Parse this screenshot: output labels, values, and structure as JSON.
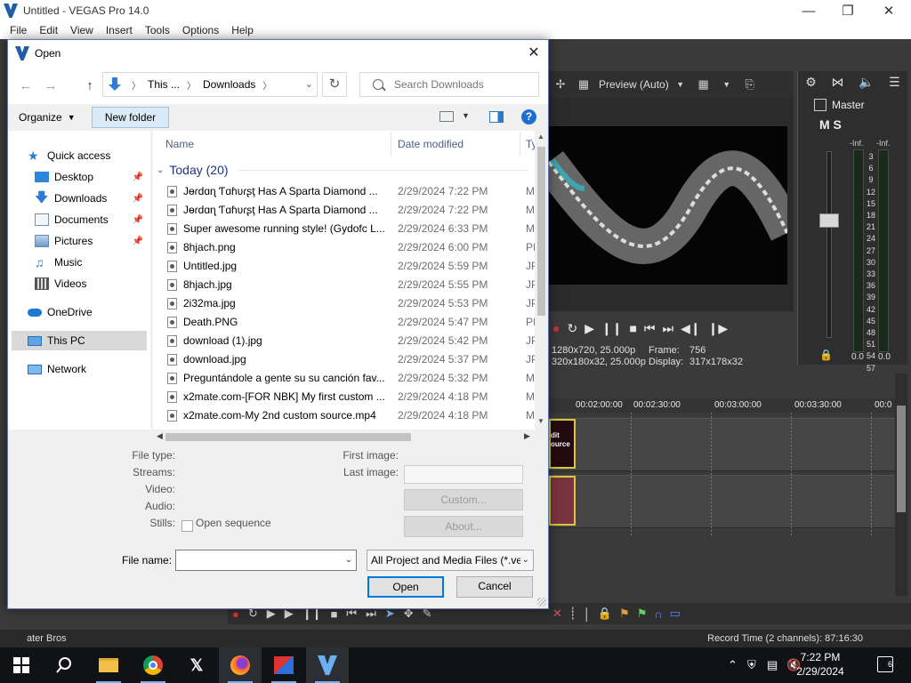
{
  "app": {
    "title": "Untitled - VEGAS Pro 14.0",
    "menu": [
      "File",
      "Edit",
      "View",
      "Insert",
      "Tools",
      "Options",
      "Help"
    ],
    "preview_quality": "Preview (Auto)",
    "project_info": "1280x720, 25.000p",
    "preview_info": "320x180x32, 25.000p",
    "frame_label": "Frame:",
    "frame_value": "756",
    "display_label": "Display:",
    "display_value": "317x178x32",
    "mixer_title": "Master",
    "mixer_ms": "M  S",
    "meter_inf": "-Inf.",
    "meter_scale": [
      "3",
      "6",
      "9",
      "12",
      "15",
      "18",
      "21",
      "24",
      "27",
      "30",
      "33",
      "36",
      "39",
      "42",
      "45",
      "48",
      "51",
      "54",
      "57"
    ],
    "meter_val": "0.0",
    "timeline_marks": [
      "00:02:00:00",
      "00:02:30:00",
      "00:03:00:00",
      "00:03:30:00",
      "00:0"
    ],
    "clip_label": "dit ource",
    "record_time": "Record Time (2 channels): 87:16:30",
    "status_left": "ater Bros"
  },
  "dialog": {
    "title": "Open",
    "close": "✕",
    "address": {
      "part1": "This ...",
      "part2": "Downloads"
    },
    "search_placeholder": "Search Downloads",
    "organize": "Organize",
    "new_folder": "New folder",
    "nav": [
      {
        "label": "Quick access"
      },
      {
        "label": "Desktop"
      },
      {
        "label": "Downloads"
      },
      {
        "label": "Documents"
      },
      {
        "label": "Pictures"
      },
      {
        "label": "Music"
      },
      {
        "label": "Videos"
      },
      {
        "label": "OneDrive"
      },
      {
        "label": "This PC"
      },
      {
        "label": "Network"
      }
    ],
    "columns": {
      "name": "Name",
      "date": "Date modified",
      "type": "Ty"
    },
    "group": "Today (20)",
    "files": [
      {
        "name": "Jɵɾԁɑɳ Ƭɑɦʋɾʂţ Has A Sparta Diamond ...",
        "date": "2/29/2024 7:22 PM",
        "type": "M"
      },
      {
        "name": "Jɵɾԁɑɳ Ƭɑɦʋɾʂţ Has A Sparta Diamond ...",
        "date": "2/29/2024 7:22 PM",
        "type": "M"
      },
      {
        "name": "Super awesome running style! (Gydofc L...",
        "date": "2/29/2024 6:33 PM",
        "type": "M"
      },
      {
        "name": "8hjach.png",
        "date": "2/29/2024 6:00 PM",
        "type": "PI"
      },
      {
        "name": "Untitled.jpg",
        "date": "2/29/2024 5:59 PM",
        "type": "JP"
      },
      {
        "name": "8hjach.jpg",
        "date": "2/29/2024 5:55 PM",
        "type": "JP"
      },
      {
        "name": "2i32ma.jpg",
        "date": "2/29/2024 5:53 PM",
        "type": "JP"
      },
      {
        "name": "Death.PNG",
        "date": "2/29/2024 5:47 PM",
        "type": "PI"
      },
      {
        "name": "download (1).jpg",
        "date": "2/29/2024 5:42 PM",
        "type": "JP"
      },
      {
        "name": "download.jpg",
        "date": "2/29/2024 5:37 PM",
        "type": "JP"
      },
      {
        "name": "Preguntándole a gente su su canción fav...",
        "date": "2/29/2024 5:32 PM",
        "type": "M"
      },
      {
        "name": "x2mate.com-[FOR NBK] My first custom ...",
        "date": "2/29/2024 4:18 PM",
        "type": "M"
      },
      {
        "name": "x2mate.com-My 2nd custom source.mp4",
        "date": "2/29/2024 4:18 PM",
        "type": "M"
      }
    ],
    "props": {
      "file_type": "File type:",
      "streams": "Streams:",
      "video": "Video:",
      "audio": "Audio:",
      "stills": "Stills:",
      "open_sequence": "Open sequence",
      "first_image": "First image:",
      "last_image": "Last image:",
      "custom": "Custom...",
      "about": "About..."
    },
    "file_name_label": "File name:",
    "file_name_value": "",
    "filter": "All Project and Media Files (*.ve",
    "open": "Open",
    "cancel": "Cancel"
  },
  "taskbar": {
    "time": "7:22 PM",
    "date": "2/29/2024",
    "notifications": "6",
    "apps": [
      "start",
      "search",
      "file-explorer",
      "chrome",
      "x",
      "firefox",
      "media-app",
      "vegas"
    ]
  }
}
